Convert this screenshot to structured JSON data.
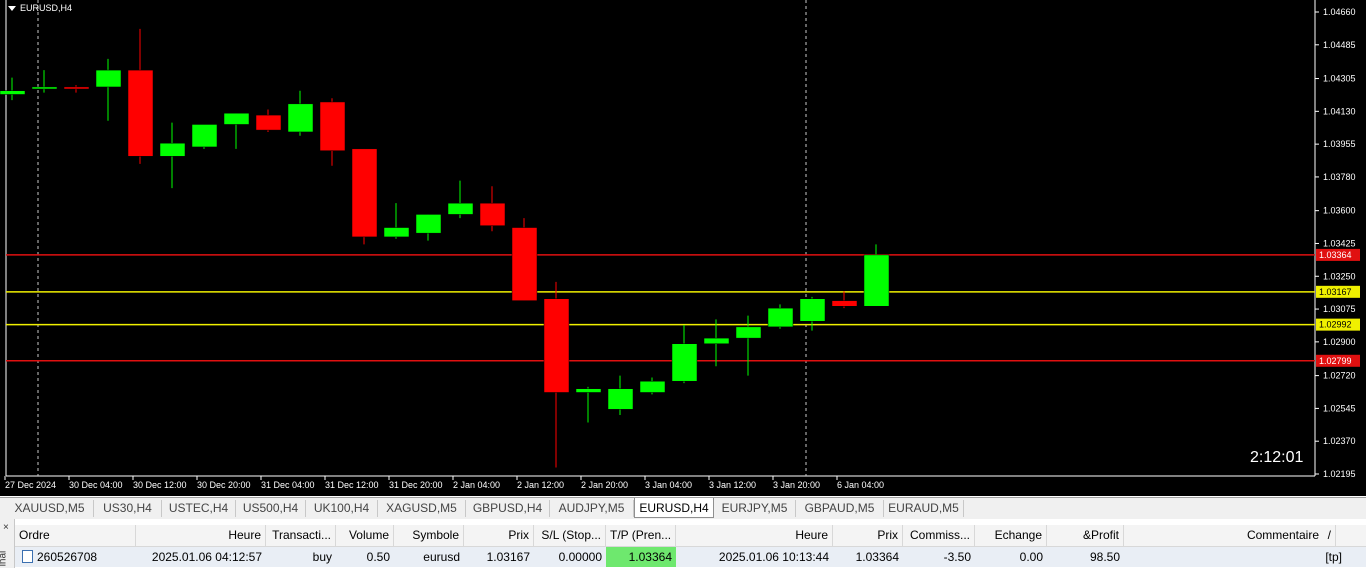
{
  "window": {
    "title": "EURUSD,H4"
  },
  "chart_data": {
    "type": "candlestick",
    "symbol": "EURUSD",
    "timeframe": "H4",
    "ylim": [
      1.0213,
      1.047
    ],
    "price_ticks": [
      "1.04660",
      "1.04485",
      "1.04305",
      "1.04130",
      "1.03955",
      "1.03780",
      "1.03600",
      "1.03425",
      "1.03250",
      "1.03075",
      "1.02900",
      "1.02720",
      "1.02545",
      "1.02370",
      "1.02195"
    ],
    "time_ticks": [
      "27 Dec 2024",
      "30 Dec 04:00",
      "30 Dec 12:00",
      "30 Dec 20:00",
      "31 Dec 04:00",
      "31 Dec 12:00",
      "31 Dec 20:00",
      "2 Jan 04:00",
      "2 Jan 12:00",
      "2 Jan 20:00",
      "3 Jan 04:00",
      "3 Jan 12:00",
      "3 Jan 20:00",
      "6 Jan 04:00"
    ],
    "candles": [
      {
        "o": 1.0422,
        "h": 1.0431,
        "l": 1.0419,
        "c": 1.0424
      },
      {
        "o": 1.0425,
        "h": 1.0435,
        "l": 1.0423,
        "c": 1.0426
      },
      {
        "o": 1.0426,
        "h": 1.0427,
        "l": 1.0423,
        "c": 1.0425
      },
      {
        "o": 1.0426,
        "h": 1.0441,
        "l": 1.0408,
        "c": 1.0435
      },
      {
        "o": 1.0435,
        "h": 1.0457,
        "l": 1.0385,
        "c": 1.0389
      },
      {
        "o": 1.0389,
        "h": 1.0407,
        "l": 1.0372,
        "c": 1.0396
      },
      {
        "o": 1.0394,
        "h": 1.0406,
        "l": 1.0393,
        "c": 1.0406
      },
      {
        "o": 1.0406,
        "h": 1.0412,
        "l": 1.0393,
        "c": 1.0412
      },
      {
        "o": 1.0411,
        "h": 1.0414,
        "l": 1.0402,
        "c": 1.0403
      },
      {
        "o": 1.0402,
        "h": 1.0424,
        "l": 1.04,
        "c": 1.0417
      },
      {
        "o": 1.0418,
        "h": 1.042,
        "l": 1.0384,
        "c": 1.0392
      },
      {
        "o": 1.0393,
        "h": 1.0393,
        "l": 1.0342,
        "c": 1.0346
      },
      {
        "o": 1.0346,
        "h": 1.0364,
        "l": 1.0345,
        "c": 1.0351
      },
      {
        "o": 1.0348,
        "h": 1.0358,
        "l": 1.0344,
        "c": 1.0358
      },
      {
        "o": 1.0358,
        "h": 1.0376,
        "l": 1.0356,
        "c": 1.0364
      },
      {
        "o": 1.0364,
        "h": 1.0373,
        "l": 1.0349,
        "c": 1.0352
      },
      {
        "o": 1.0351,
        "h": 1.0356,
        "l": 1.0312,
        "c": 1.0312
      },
      {
        "o": 1.0313,
        "h": 1.0322,
        "l": 1.0223,
        "c": 1.0263
      },
      {
        "o": 1.0263,
        "h": 1.0266,
        "l": 1.0247,
        "c": 1.0265
      },
      {
        "o": 1.0254,
        "h": 1.0272,
        "l": 1.0251,
        "c": 1.0265
      },
      {
        "o": 1.0263,
        "h": 1.0271,
        "l": 1.0262,
        "c": 1.0269
      },
      {
        "o": 1.0269,
        "h": 1.0299,
        "l": 1.0268,
        "c": 1.0289
      },
      {
        "o": 1.0289,
        "h": 1.0302,
        "l": 1.0277,
        "c": 1.0292
      },
      {
        "o": 1.0292,
        "h": 1.0304,
        "l": 1.0272,
        "c": 1.0298
      },
      {
        "o": 1.0298,
        "h": 1.031,
        "l": 1.0297,
        "c": 1.0308
      },
      {
        "o": 1.0301,
        "h": 1.0314,
        "l": 1.0296,
        "c": 1.0313
      },
      {
        "o": 1.0312,
        "h": 1.0317,
        "l": 1.0308,
        "c": 1.0309
      },
      {
        "o": 1.0309,
        "h": 1.0342,
        "l": 1.0309,
        "c": 1.03364
      }
    ],
    "levels": [
      {
        "price": 1.03364,
        "label": "1.03364",
        "color": "#e01010"
      },
      {
        "price": 1.03167,
        "label": "1.03167",
        "color": "#f0f000"
      },
      {
        "price": 1.02992,
        "label": "1.02992",
        "color": "#f0f000"
      },
      {
        "price": 1.02799,
        "label": "1.02799",
        "color": "#e01010"
      }
    ],
    "bull_color": "#00ff00",
    "bear_color": "#ff0000",
    "background": "#000000"
  },
  "timer": "2:12:01",
  "symbol_tabs": [
    "XAUUSD,M5",
    "US30,H4",
    "USTEC,H4",
    "US500,H4",
    "UK100,H4",
    "XAGUSD,M5",
    "GBPUSD,H4",
    "AUDJPY,M5",
    "EURUSD,H4",
    "EURJPY,M5",
    "GBPAUD,M5",
    "EURAUD,M5"
  ],
  "active_tab": "EURUSD,H4",
  "terminal": {
    "side_close": "×",
    "side_label": "inal",
    "columns": [
      "Ordre",
      "Heure",
      "Transacti...",
      "Volume",
      "Symbole",
      "Prix",
      "S/L (Stop...",
      "T/P (Pren...",
      "Heure",
      "Prix",
      "Commiss...",
      "Echange",
      "&Profit",
      "Commentaire"
    ],
    "sort_indicator": "/",
    "row": {
      "ordre": "260526708",
      "heure": "2025.01.06 04:12:57",
      "transaction": "buy",
      "volume": "0.50",
      "symbole": "eurusd",
      "prix": "1.03167",
      "sl": "0.00000",
      "tp": "1.03364",
      "heure2": "2025.01.06 10:13:44",
      "prix2": "1.03364",
      "commission": "-3.50",
      "echange": "0.00",
      "profit": "98.50",
      "commentaire": "[tp]"
    }
  }
}
